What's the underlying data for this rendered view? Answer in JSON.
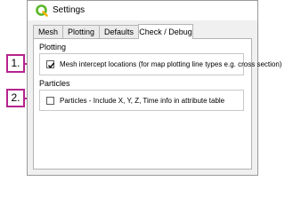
{
  "window": {
    "title": "Settings",
    "icon": "qgis-logo-icon"
  },
  "tabs": [
    {
      "label": "Mesh",
      "active": false
    },
    {
      "label": "Plotting",
      "active": false
    },
    {
      "label": "Defaults",
      "active": false
    },
    {
      "label": "Check / Debug",
      "active": true
    }
  ],
  "sections": {
    "plotting": {
      "label": "Plotting",
      "option": {
        "label": "Mesh intercept locations (for map plotting line types e.g. cross section)",
        "checked": true
      }
    },
    "particles": {
      "label": "Particles",
      "option": {
        "label": "Particles - Include X, Y, Z, Time info in attribute table",
        "checked": false
      }
    }
  },
  "callouts": [
    "1.",
    "2."
  ],
  "colors": {
    "callout": "#b5238d",
    "qgis_green": "#5ab829"
  }
}
